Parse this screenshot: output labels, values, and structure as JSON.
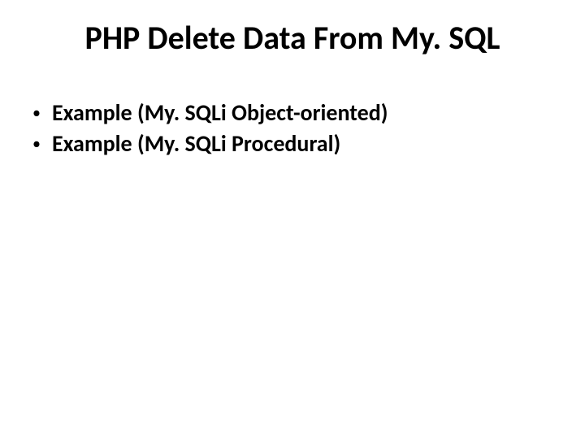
{
  "slide": {
    "title": "PHP Delete Data From My. SQL",
    "bullets": [
      {
        "text": "Example (My. SQLi Object-oriented)"
      },
      {
        "text": "Example (My. SQLi Procedural)"
      }
    ],
    "bullet_glyph": "•"
  }
}
